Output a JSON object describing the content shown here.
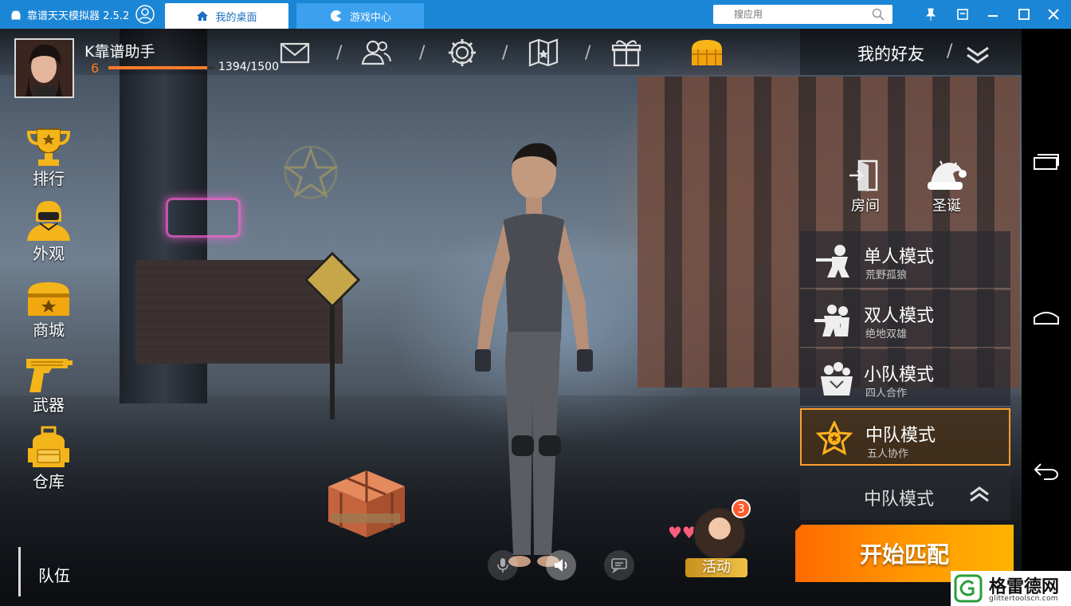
{
  "emulator": {
    "title": "靠谱天天模拟器 2.5.2",
    "tabs": [
      {
        "label": "我的桌面"
      },
      {
        "label": "游戏中心"
      }
    ],
    "search_placeholder": "搜应用"
  },
  "player": {
    "name": "K靠谱助手",
    "level": "6",
    "xp_text": "1394/1500",
    "xp_fraction": 0.929
  },
  "top_icons": [
    "mail-icon",
    "friends-icon",
    "settings-icon",
    "map-icon",
    "gift-icon",
    "chest-icon"
  ],
  "friends": {
    "label": "我的好友"
  },
  "left_menu": [
    {
      "label": "排行",
      "icon": "trophy-icon"
    },
    {
      "label": "外观",
      "icon": "outfit-icon"
    },
    {
      "label": "商城",
      "icon": "shop-icon"
    },
    {
      "label": "武器",
      "icon": "weapon-icon"
    },
    {
      "label": "仓库",
      "icon": "backpack-icon"
    }
  ],
  "team": {
    "label": "队伍"
  },
  "right_icons": [
    {
      "label": "房间",
      "icon": "room-door-icon"
    },
    {
      "label": "圣诞",
      "icon": "christmas-hat-icon"
    }
  ],
  "modes": [
    {
      "name": "单人模式",
      "sub": "荒野孤狼",
      "icon": "solo-soldier-icon"
    },
    {
      "name": "双人模式",
      "sub": "绝地双雄",
      "icon": "duo-soldier-icon"
    },
    {
      "name": "小队模式",
      "sub": "四人合作",
      "icon": "squad-soldier-icon"
    },
    {
      "name": "中队模式",
      "sub": "五人协作",
      "icon": "star-badge-icon",
      "selected": true
    }
  ],
  "mode_selector": {
    "label": "中队模式"
  },
  "start_button": {
    "label": "开始匹配"
  },
  "activity": {
    "label": "活动",
    "badge": "3"
  },
  "watermark": {
    "name": "格雷德网",
    "url": "glittertoolscn.com"
  },
  "colors": {
    "accent": "#ff8a00",
    "emulator_blue": "#1c86d6",
    "selected_border": "#ff9e2d"
  }
}
